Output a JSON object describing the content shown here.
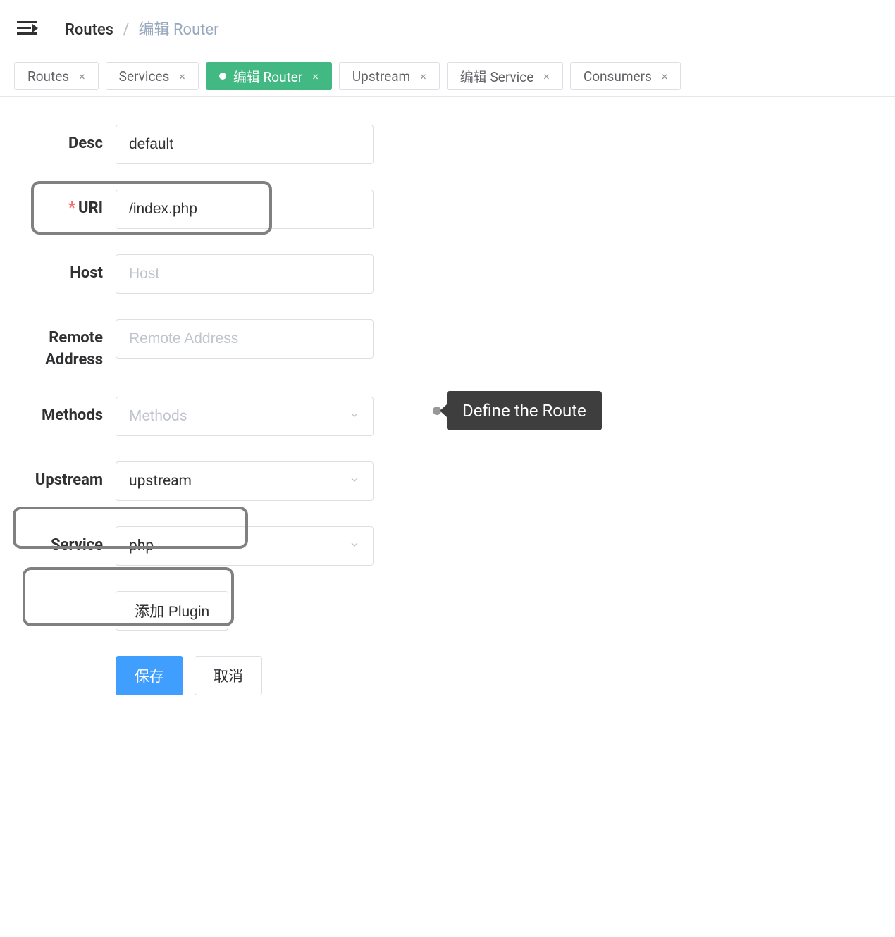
{
  "breadcrumb": {
    "root": "Routes",
    "current": "编辑 Router"
  },
  "tabs": [
    {
      "label": "Routes",
      "active": false
    },
    {
      "label": "Services",
      "active": false
    },
    {
      "label": "编辑 Router",
      "active": true
    },
    {
      "label": "Upstream",
      "active": false
    },
    {
      "label": "编辑 Service",
      "active": false
    },
    {
      "label": "Consumers",
      "active": false
    }
  ],
  "form": {
    "desc": {
      "label": "Desc",
      "value": "default",
      "placeholder": ""
    },
    "uri": {
      "label": "URI",
      "value": "/index.php",
      "placeholder": "",
      "required": true
    },
    "host": {
      "label": "Host",
      "value": "",
      "placeholder": "Host"
    },
    "remote": {
      "label": "Remote Address",
      "value": "",
      "placeholder": "Remote Address"
    },
    "methods": {
      "label": "Methods",
      "value": "",
      "placeholder": "Methods"
    },
    "upstream": {
      "label": "Upstream",
      "value": "upstream"
    },
    "service": {
      "label": "Service",
      "value": "php"
    },
    "add_plugin_label": "添加 Plugin",
    "save_label": "保存",
    "cancel_label": "取消"
  },
  "tooltip": {
    "text": "Define the Route"
  }
}
